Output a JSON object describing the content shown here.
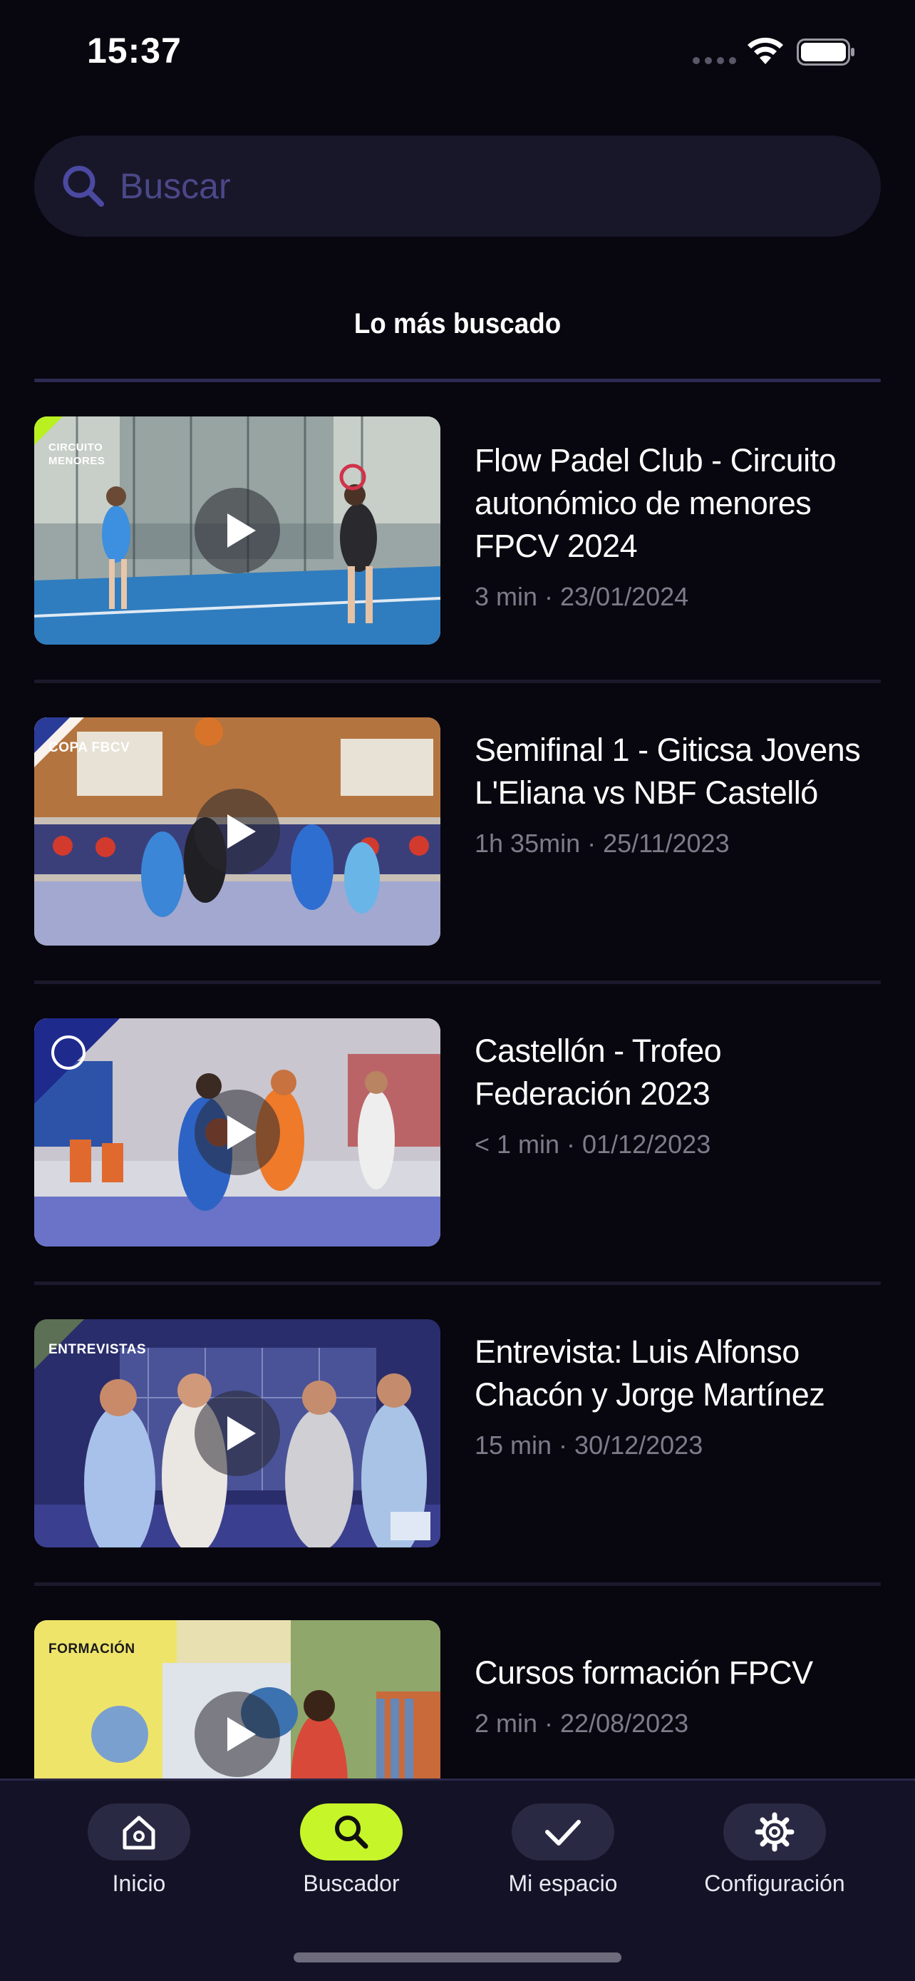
{
  "status_bar": {
    "time": "15:37"
  },
  "search": {
    "placeholder": "Buscar"
  },
  "tab": {
    "label": "Lo más buscado"
  },
  "results": [
    {
      "title": " Flow Padel Club - Circuito autonómico de menores FPCV 2024",
      "meta": "3 min · 23/01/2024",
      "tag": "CIRCUITO MENORES"
    },
    {
      "title": "Semifinal 1 - Giticsa Jovens L'Eliana vs NBF Castelló",
      "meta": "1h 35min · 25/11/2023",
      "tag": "COPA FBCV"
    },
    {
      "title": "Castellón - Trofeo Federación 2023",
      "meta": "< 1 min · 01/12/2023",
      "tag": ""
    },
    {
      "title": "Entrevista: Luis Alfonso Chacón y Jorge Martínez",
      "meta": "15 min · 30/12/2023",
      "tag": "ENTREVISTAS"
    },
    {
      "title": "Cursos formación FPCV",
      "meta": "2 min · 22/08/2023",
      "tag": "FORMACIÓN"
    }
  ],
  "nav": [
    {
      "label": "Inicio",
      "icon": "home-icon"
    },
    {
      "label": "Buscador",
      "icon": "search-icon",
      "active": true
    },
    {
      "label": "Mi espacio",
      "icon": "check-icon"
    },
    {
      "label": "Configuración",
      "icon": "gear-icon"
    }
  ],
  "colors": {
    "background": "#08060e",
    "accent": "#c6f52a",
    "nav_bg": "#141226",
    "search_bg": "#181629"
  }
}
